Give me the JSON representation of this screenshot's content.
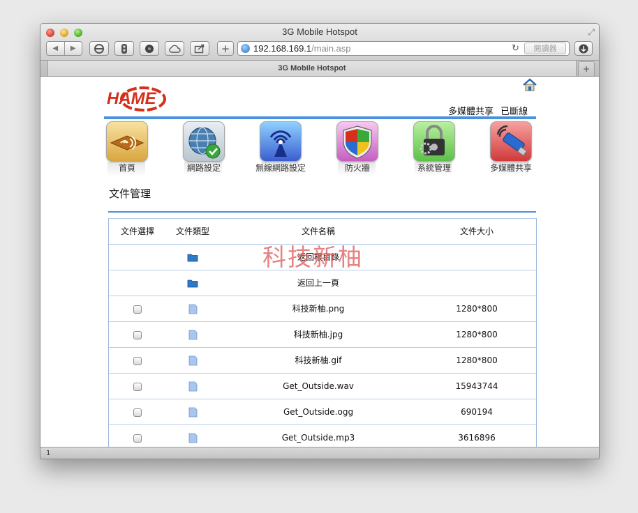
{
  "window": {
    "title": "3G Mobile Hotspot"
  },
  "toolbar": {
    "back": "◀",
    "forward": "▶",
    "add": "+"
  },
  "address": {
    "host": "192.168.169.1",
    "path": "/main.asp",
    "reader": "閱讀器"
  },
  "tab": {
    "title": "3G Mobile Hotspot",
    "new_tab": "+"
  },
  "header": {
    "logo_text": "HAME",
    "media_share": "多媒體共享",
    "connection_status": "已斷線"
  },
  "nav": [
    {
      "label": "首頁",
      "icon": "home-speaker-icon"
    },
    {
      "label": "網路設定",
      "icon": "globe-check-icon"
    },
    {
      "label": "無線網路設定",
      "icon": "wireless-antenna-icon"
    },
    {
      "label": "防火牆",
      "icon": "firewall-shield-icon"
    },
    {
      "label": "系統管理",
      "icon": "padlock-gear-icon"
    },
    {
      "label": "多媒體共享",
      "icon": "usb-stick-icon"
    }
  ],
  "page_title": "文件管理",
  "table": {
    "headers": [
      "文件選擇",
      "文件類型",
      "文件名稱",
      "文件大小"
    ],
    "rows": [
      {
        "checkbox": false,
        "type": "folder",
        "name": "返回根目錄",
        "size": ""
      },
      {
        "checkbox": false,
        "type": "folder",
        "name": "返回上一頁",
        "size": ""
      },
      {
        "checkbox": true,
        "type": "file",
        "name": "科技新柚.png",
        "size": "1280*800"
      },
      {
        "checkbox": true,
        "type": "file",
        "name": "科技新柚.jpg",
        "size": "1280*800"
      },
      {
        "checkbox": true,
        "type": "file",
        "name": "科技新柚.gif",
        "size": "1280*800"
      },
      {
        "checkbox": true,
        "type": "file",
        "name": "Get_Outside.wav",
        "size": "15943744"
      },
      {
        "checkbox": true,
        "type": "file",
        "name": "Get_Outside.ogg",
        "size": "690194"
      },
      {
        "checkbox": true,
        "type": "file",
        "name": "Get_Outside.mp3",
        "size": "3616896"
      }
    ]
  },
  "watermark": "科技新柚",
  "status_bar": "1",
  "colors": {
    "accent_blue": "#4a90e0",
    "logo_red": "#d6301c",
    "watermark": "#dc5a5a"
  }
}
